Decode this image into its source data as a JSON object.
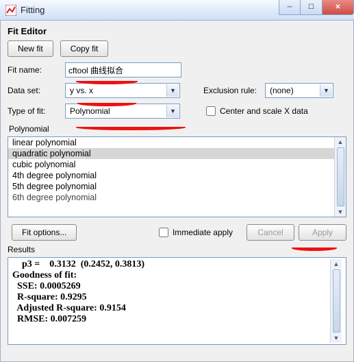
{
  "window": {
    "title": "Fitting",
    "min_label": "−",
    "max_label": "▢",
    "close_label": "×"
  },
  "editor": {
    "heading": "Fit Editor",
    "new_fit_btn": "New fit",
    "copy_fit_btn": "Copy fit",
    "fit_name_label": "Fit name:",
    "fit_name_value": "cftool 曲线拟合",
    "data_set_label": "Data set:",
    "data_set_value": "y vs. x",
    "exclusion_label": "Exclusion rule:",
    "exclusion_value": "(none)",
    "type_of_fit_label": "Type of fit:",
    "type_of_fit_value": "Polynomial",
    "center_scale_label": "Center and scale X data",
    "center_scale_checked": false
  },
  "poly_group_label": "Polynomial",
  "poly_list": [
    {
      "label": "linear polynomial",
      "selected": false
    },
    {
      "label": "quadratic polynomial",
      "selected": true
    },
    {
      "label": "cubic polynomial",
      "selected": false
    },
    {
      "label": "4th degree polynomial",
      "selected": false
    },
    {
      "label": "5th degree polynomial",
      "selected": false
    },
    {
      "label": "6th degree polynomial",
      "selected": false
    }
  ],
  "actions": {
    "fit_options_btn": "Fit options...",
    "immediate_apply_label": "Immediate apply",
    "immediate_apply_checked": false,
    "cancel_btn": "Cancel",
    "apply_btn": "Apply"
  },
  "results": {
    "label": "Results",
    "lines": [
      "    p3 =    0.3132  (0.2452, 0.3813)",
      "",
      "Goodness of fit:",
      "  SSE: 0.0005269",
      "  R-square: 0.9295",
      "  Adjusted R-square: 0.9154",
      "  RMSE: 0.007259"
    ]
  }
}
